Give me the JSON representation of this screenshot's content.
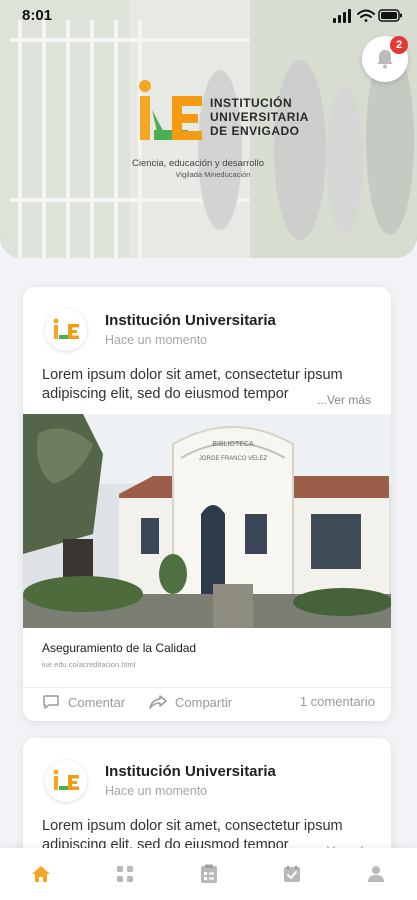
{
  "status_bar": {
    "time": "8:01"
  },
  "notifications": {
    "count": "2"
  },
  "hero": {
    "logo_initials": "IUE",
    "logo_lines": [
      "INSTITUCIÓN",
      "UNIVERSITARIA",
      "DE ENVIGADO"
    ],
    "tagline": "Ciencia, educación y desarrollo",
    "subline": "Vigilada Mineducación"
  },
  "posts": [
    {
      "author": "Institución Universitaria",
      "time": "Hace un momento",
      "text": "Lorem ipsum dolor sit amet, consectetur ipsum adipiscing elit, sed do eiusmod tempor",
      "more": "...Ver más",
      "image_sign": [
        "BIBLIOTECA",
        "JORGE FRANCO VELEZ"
      ],
      "link_title": "Aseguramiento de la Calidad",
      "link_url": "iue.edu.co/acreditacion.html",
      "comment_label": "Comentar",
      "share_label": "Compartir",
      "comment_count": "1 comentario"
    },
    {
      "author": "Institución Universitaria",
      "time": "Hace un momento",
      "text": "Lorem ipsum dolor sit amet, consectetur ipsum adipiscing elit, sed do eiusmod tempor",
      "more": "...Ver más"
    }
  ],
  "nav": {
    "items": [
      "home-icon",
      "grid-icon",
      "clipboard-icon",
      "calendar-check-icon",
      "profile-icon"
    ],
    "active_color": "#f5a623",
    "inactive_color": "#b9b9b9"
  },
  "colors": {
    "accent": "#f5a623",
    "badge": "#e53935",
    "brand_green": "#4caf50",
    "brand_orange": "#f39c12"
  }
}
